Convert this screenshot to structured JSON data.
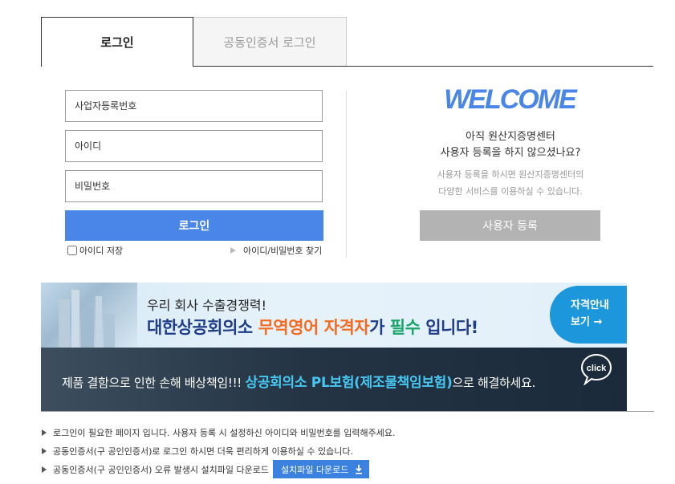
{
  "tabs": {
    "login": "로그인",
    "cert_login": "공동인증서 로그인"
  },
  "form": {
    "business_number_placeholder": "사업자등록번호",
    "id_placeholder": "아이디",
    "password_placeholder": "비밀번호",
    "login_button": "로그인",
    "remember_id": "아이디 저장",
    "find_account": "아이디/비밀번호 찾기"
  },
  "welcome": {
    "title": "WELCOME",
    "line1": "아직 원산지증명센터",
    "line2": "사용자 등록을 하지 않으셨나요?",
    "desc1": "사용자 등록을 하시면 원산지증명센터의",
    "desc2": "다양한 서비스를 이용하실 수 있습니다.",
    "register_button": "사용자 등록"
  },
  "banner_exam": {
    "line1": "우리 회사 수출경쟁력!",
    "part1": "대한상공회의소 ",
    "part2": "무역영어 자격자",
    "part3": "가 ",
    "part4": "필수",
    "part5": " 입니다!",
    "cta_line1": "자격안내",
    "cta_line2": "보기 →"
  },
  "banner_insurance": {
    "part1": "제품 결함으로 인한 손해 배상책임!!! ",
    "part2": "상공회의소 PL보험(제조물책임보험)",
    "part3": "으로 해결하세요.",
    "click_label": "click"
  },
  "notices": {
    "n1": "로그인이 필요한 페이지 입니다. 사용자 등록 시 설정하신 아이디와 비밀번호를 입력해주세요.",
    "n2": "공동인증서(구 공인인증서)로 로그인 하시면 더욱 편리하게 이용하실 수 있습니다.",
    "n3": "공동인증서(구 공인인증서) 오류 발생시 설치파일 다운로드",
    "download_button": "설치파일 다운로드"
  },
  "colors": {
    "primary": "#4a86e8",
    "cta": "#1c97dc",
    "orange": "#f26b21",
    "green": "#18a56a",
    "highlight": "#47c7f2"
  }
}
